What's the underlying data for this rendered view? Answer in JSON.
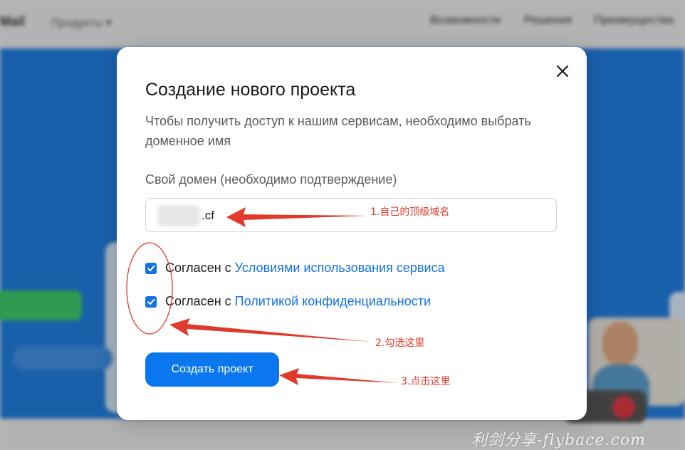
{
  "background": {
    "logo": "Mail",
    "products": "Продукты ▾",
    "nav": [
      "Возможности",
      "Решения",
      "Преимущества"
    ]
  },
  "modal": {
    "title": "Создание нового проекта",
    "description": "Чтобы получить доступ к нашим сервисам, необходимо выбрать доменное имя",
    "domain_label": "Свой домен (необходимо подтверждение)",
    "domain_value": ".cf",
    "agreements": [
      {
        "prefix": "Согласен с",
        "link": "Условиями использования сервиса",
        "checked": true
      },
      {
        "prefix": "Согласен с",
        "link": "Политикой конфиденциальности",
        "checked": true
      }
    ],
    "submit_label": "Создать проект"
  },
  "annotations": {
    "step1": "1.自己的顶级域名",
    "step2": "2.勾选这里",
    "step3": "3.点击这里",
    "color": "#e03a2c"
  },
  "watermark": "利剑分享-flybace.com",
  "colors": {
    "accent": "#0a77ee",
    "link": "#1271e6",
    "hero": "#0a72e0"
  }
}
